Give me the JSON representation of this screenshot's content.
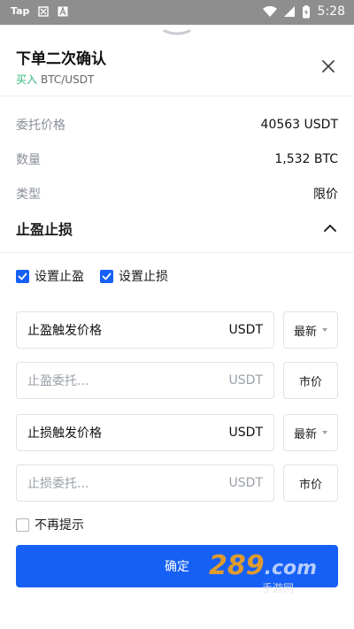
{
  "status_bar": {
    "app": "Tap",
    "time": "5:28"
  },
  "header": {
    "title": "下单二次确认",
    "side": "买入",
    "pair": "BTC/USDT"
  },
  "details": [
    {
      "label": "委托价格",
      "value": "40563 USDT"
    },
    {
      "label": "数量",
      "value": "1,532 BTC"
    },
    {
      "label": "类型",
      "value": "限价"
    }
  ],
  "tpsl": {
    "title": "止盈止损",
    "set_tp_label": "设置止盈",
    "set_sl_label": "设置止损",
    "set_tp_checked": true,
    "set_sl_checked": true,
    "tp_trigger": {
      "label": "止盈触发价格",
      "unit": "USDT",
      "selector": "最新"
    },
    "tp_order": {
      "placeholder": "止盈委托...",
      "unit": "USDT",
      "button": "市价"
    },
    "sl_trigger": {
      "label": "止损触发价格",
      "unit": "USDT",
      "selector": "最新"
    },
    "sl_order": {
      "placeholder": "止损委托...",
      "unit": "USDT",
      "button": "市价"
    }
  },
  "no_more_prompt": "不再提示",
  "confirm_label": "确定",
  "watermark": {
    "num": "289",
    "suffix": ".com",
    "sub": "手游网"
  },
  "colors": {
    "accent": "#1660f5",
    "buy": "#2fb679"
  }
}
